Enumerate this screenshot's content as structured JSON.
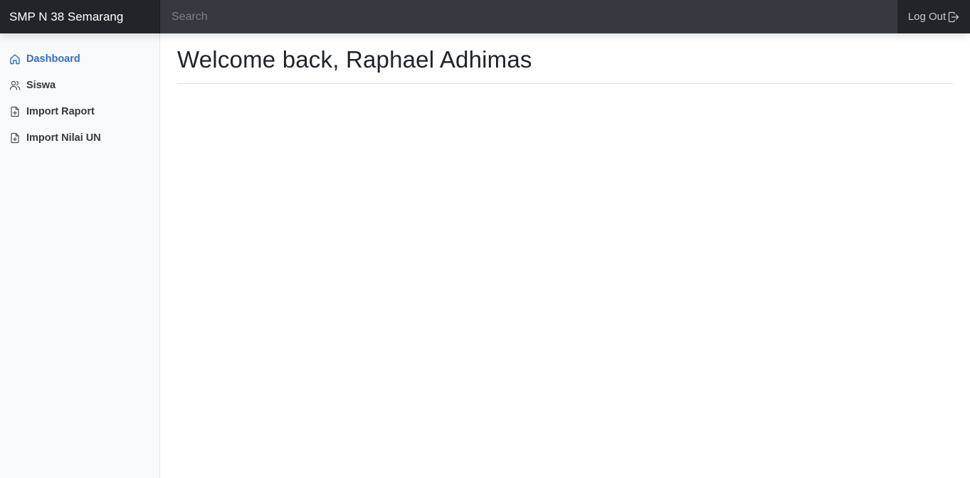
{
  "header": {
    "brand": "SMP N 38 Semarang",
    "search_placeholder": "Search",
    "logout_label": "Log Out",
    "logout_icon": "box-arrow-right-icon"
  },
  "sidebar": {
    "items": [
      {
        "label": "Dashboard",
        "icon": "home-icon",
        "active": true
      },
      {
        "label": "Siswa",
        "icon": "users-icon",
        "active": false
      },
      {
        "label": "Import Raport",
        "icon": "file-plus-icon",
        "active": false
      },
      {
        "label": "Import Nilai UN",
        "icon": "file-plus-icon",
        "active": false
      }
    ],
    "active_color": "#2f6fcb"
  },
  "main": {
    "heading": "Welcome back, Raphael Adhimas"
  }
}
